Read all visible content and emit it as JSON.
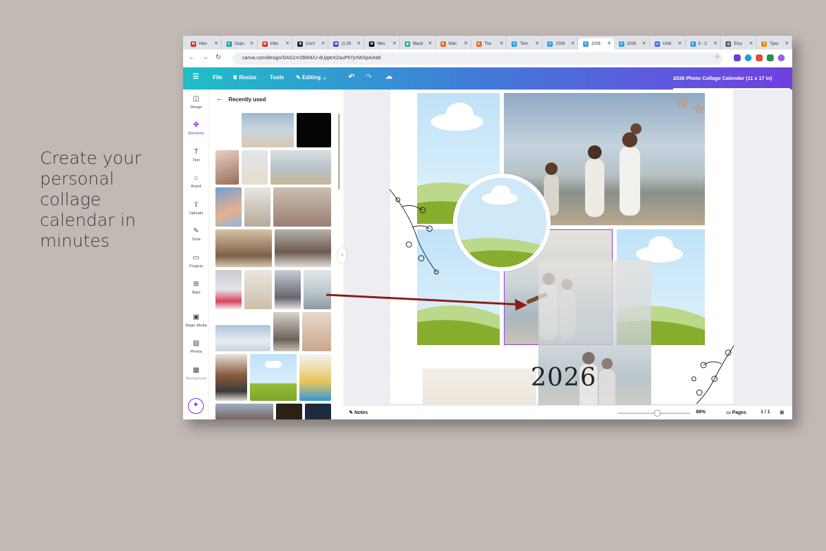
{
  "tagline": "Create your\npersonal\ncollage\ncalendar in\nminutes",
  "browser": {
    "tabs": [
      {
        "label": "Inbo",
        "color": "#d93025",
        "glyph": "M"
      },
      {
        "label": "Ceps",
        "color": "#1ea3b3",
        "glyph": "C"
      },
      {
        "label": "Inbo",
        "color": "#d93025",
        "glyph": "M"
      },
      {
        "label": "Conf",
        "color": "#222222",
        "glyph": "B"
      },
      {
        "label": "(1,05",
        "color": "#6b3fd0",
        "glyph": "✉"
      },
      {
        "label": "Mes",
        "color": "#111111",
        "glyph": "M"
      },
      {
        "label": "Black",
        "color": "#2bb3a3",
        "glyph": "◆"
      },
      {
        "label": "Mari",
        "color": "#f1641e",
        "glyph": "E"
      },
      {
        "label": "The",
        "color": "#f1641e",
        "glyph": "E"
      },
      {
        "label": "Tem",
        "color": "#2d9ee0",
        "glyph": "C"
      },
      {
        "label": "2026",
        "color": "#2d9ee0",
        "glyph": "C"
      },
      {
        "label": "2026",
        "color": "#2d9ee0",
        "glyph": "C",
        "active": true
      },
      {
        "label": "2026",
        "color": "#2d9ee0",
        "glyph": "C"
      },
      {
        "label": "Untit",
        "color": "#4a6cf0",
        "glyph": "▭"
      },
      {
        "label": "6 - C",
        "color": "#2d9ee0",
        "glyph": "C"
      },
      {
        "label": "Etsy",
        "color": "#555555",
        "glyph": "◎"
      },
      {
        "label": "Трас",
        "color": "#f28b00",
        "glyph": "T"
      }
    ],
    "url": "canva.com/design/DAG1rnZBi64/U-dUjqteXZauP87jcN6SpA/edit"
  },
  "toolbar": {
    "menu_icon": "☰",
    "file": "File",
    "resize": "Resize",
    "tools": "Tools",
    "editing": "Editing",
    "doc_title": "2026  Photo Collage Calendar (11 x 17 in)"
  },
  "rail": [
    {
      "label": "Design",
      "icon": "◫"
    },
    {
      "label": "Elements",
      "icon": "✤",
      "active": true
    },
    {
      "label": "Text",
      "icon": "T"
    },
    {
      "label": "Brand",
      "icon": "⌂"
    },
    {
      "label": "Uploads",
      "icon": "⇪"
    },
    {
      "label": "Tools",
      "icon": "✎"
    },
    {
      "label": "Projects",
      "icon": "▭"
    },
    {
      "label": "Apps",
      "icon": "⊞"
    },
    {
      "label": "Magic Media",
      "icon": "▣"
    },
    {
      "label": "Photos",
      "icon": "▨"
    },
    {
      "label": "Background",
      "icon": "▦"
    }
  ],
  "panel": {
    "title": "Recently used"
  },
  "canvas": {
    "year": "2026"
  },
  "bottom": {
    "notes": "Notes",
    "zoom": "88%",
    "zoom_fraction": 0.55,
    "pages": "Pages",
    "page_count": "1 / 1"
  }
}
